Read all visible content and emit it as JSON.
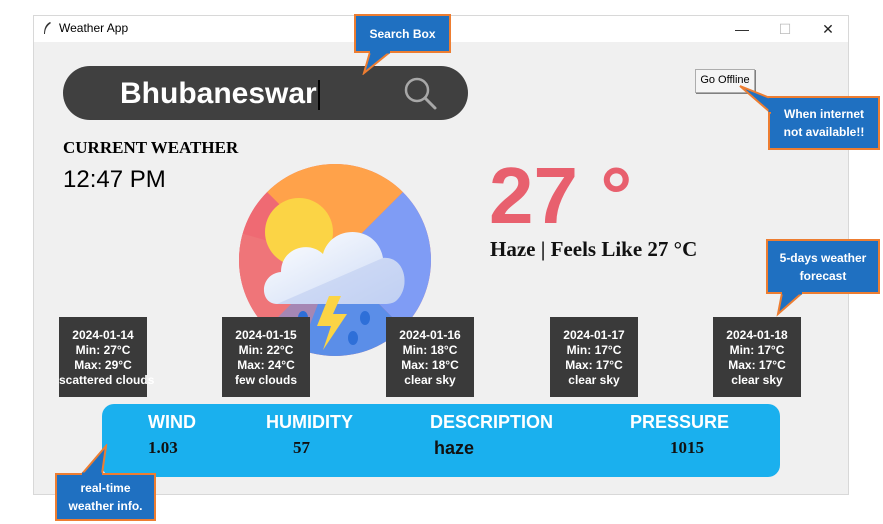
{
  "window": {
    "title": "Weather App"
  },
  "search": {
    "value": "Bhubaneswar"
  },
  "offline_button": {
    "label": "Go Offline"
  },
  "current": {
    "heading": "CURRENT WEATHER",
    "time": "12:47 PM",
    "temperature": "27 °",
    "condition": "Haze | Feels Like 27 °C"
  },
  "forecast": [
    {
      "date": "2024-01-14",
      "min": "Min: 27°C",
      "max": "Max: 29°C",
      "desc": "scattered clouds"
    },
    {
      "date": "2024-01-15",
      "min": "Min: 22°C",
      "max": "Max: 24°C",
      "desc": "few clouds"
    },
    {
      "date": "2024-01-16",
      "min": "Min: 18°C",
      "max": "Max: 18°C",
      "desc": "clear sky"
    },
    {
      "date": "2024-01-17",
      "min": "Min: 17°C",
      "max": "Max: 17°C",
      "desc": "clear sky"
    },
    {
      "date": "2024-01-18",
      "min": "Min: 17°C",
      "max": "Max: 17°C",
      "desc": "clear sky"
    }
  ],
  "info": {
    "wind": {
      "label": "WIND",
      "value": "1.03"
    },
    "humidity": {
      "label": "HUMIDITY",
      "value": "57"
    },
    "description": {
      "label": "DESCRIPTION",
      "value": "haze"
    },
    "pressure": {
      "label": "PRESSURE",
      "value": "1015"
    }
  },
  "callouts": {
    "search": "Search Box",
    "offline_1": "When internet",
    "offline_2": "not available!!",
    "forecast_1": "5-days weather",
    "forecast_2": "forecast",
    "realtime_1": "real-time",
    "realtime_2": "weather info."
  },
  "colors": {
    "temperature": "#e8606e",
    "info_bar": "#1ab0ee",
    "search_bar": "#404040",
    "callout_fill": "#1f70c1",
    "callout_border": "#ed7d31"
  },
  "icons": {
    "app": "feather-icon",
    "search": "magnifier-icon",
    "weather": "cloud-sun-thunder-rain-icon"
  }
}
